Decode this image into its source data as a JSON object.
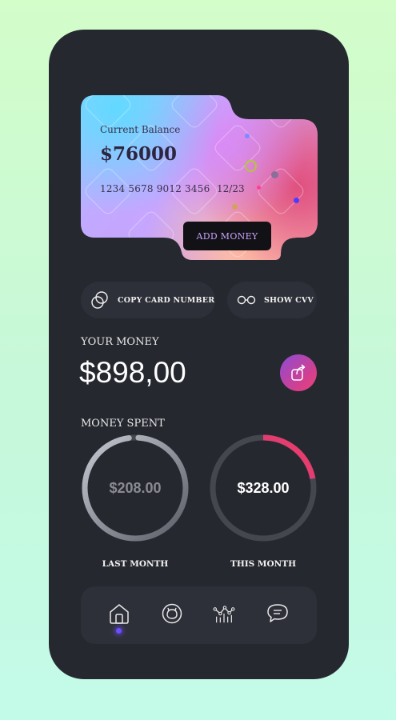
{
  "card": {
    "label": "Current Balance",
    "balance": "$76000",
    "number": "1234 5678 9012 3456",
    "expiry": "12/23",
    "add_money_label": "ADD MONEY"
  },
  "actions": {
    "copy_label": "COPY CARD NUMBER",
    "cvv_label": "SHOW CVV"
  },
  "money": {
    "label": "YOUR MONEY",
    "value": "$898,00"
  },
  "spent": {
    "label": "MONEY SPENT",
    "last_month": {
      "value": "$208.00",
      "caption": "LAST MONTH",
      "progress": 0.97
    },
    "this_month": {
      "value": "$328.00",
      "caption": "THIS MONTH",
      "progress": 0.22
    }
  },
  "nav": {
    "items": [
      "home-icon",
      "wallet-icon",
      "chart-icon",
      "chat-icon"
    ],
    "active": 0
  },
  "colors": {
    "phone_bg": "#262830",
    "accent_pink": "#d53f8c",
    "accent_purple": "#8d4cd6",
    "nav_indicator": "#6b4cff"
  }
}
